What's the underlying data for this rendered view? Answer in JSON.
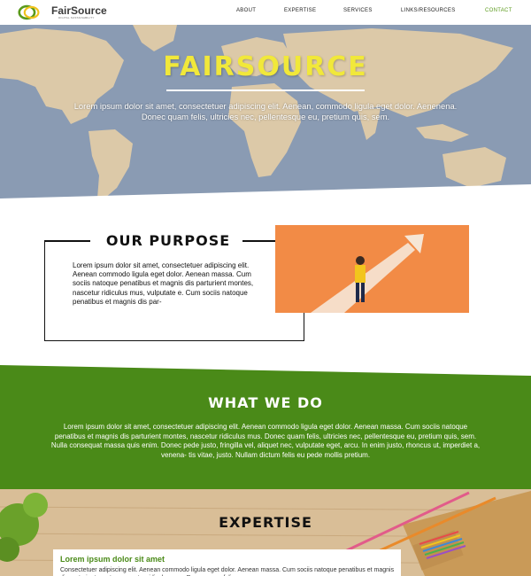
{
  "brand": {
    "name": "FairSource",
    "tagline": "DIGITAL SUSTAINABILITY",
    "colors": {
      "green": "#4a8a18",
      "yellow": "#f1e83a",
      "orange": "#f28b46"
    }
  },
  "nav": {
    "items": [
      {
        "label": "ABOUT"
      },
      {
        "label": "EXPERTISE"
      },
      {
        "label": "SERVICES"
      },
      {
        "label": "LINKS/RESOURCES"
      },
      {
        "label": "CONTACT",
        "active": true
      }
    ]
  },
  "hero": {
    "title": "FAIRSOURCE",
    "text": "Lorem ipsum dolor sit amet, consectetuer adipiscing elit. Aenean, commodo ligula eget dolor. Aenenena. Donec quam felis, ultricies nec, pellentesque eu, pretium quis, sem."
  },
  "purpose": {
    "title": "OUR PURPOSE",
    "text": "Lorem ipsum dolor sit amet, consectetuer adipiscing elit. Aenean commodo ligula eget dolor. Aenean massa. Cum sociis natoque penatibus et magnis dis parturient montes, nascetur ridiculus mus, vulputate e. Cum sociis natoque penatibus et magnis dis par-"
  },
  "whatwedo": {
    "title": "WHAT WE DO",
    "text": "Lorem ipsum dolor sit amet, consectetuer adipiscing elit. Aenean commodo ligula eget dolor. Aenean massa. Cum sociis natoque penatibus et magnis dis parturient montes, nascetur ridiculus mus. Donec quam felis, ultricies nec, pellentesque eu, pretium quis, sem. Nulla consequat massa quis enim. Donec pede justo, fringilla vel, aliquet nec, vulputate eget, arcu. In enim justo, rhoncus ut, imperdiet a, venena- tis vitae, justo. Nullam dictum felis eu pede mollis pretium."
  },
  "expertise": {
    "title": "EXPERTISE",
    "card_title": "Lorem ipsum dolor sit amet",
    "card_text": "Consectetuer adipiscing elit. Aenean commodo ligula eget dolor. Aenean massa. Cum sociis natoque penatibus et magnis dis parturient montes, nascetur ridiculus mus. Donec quam felis."
  }
}
